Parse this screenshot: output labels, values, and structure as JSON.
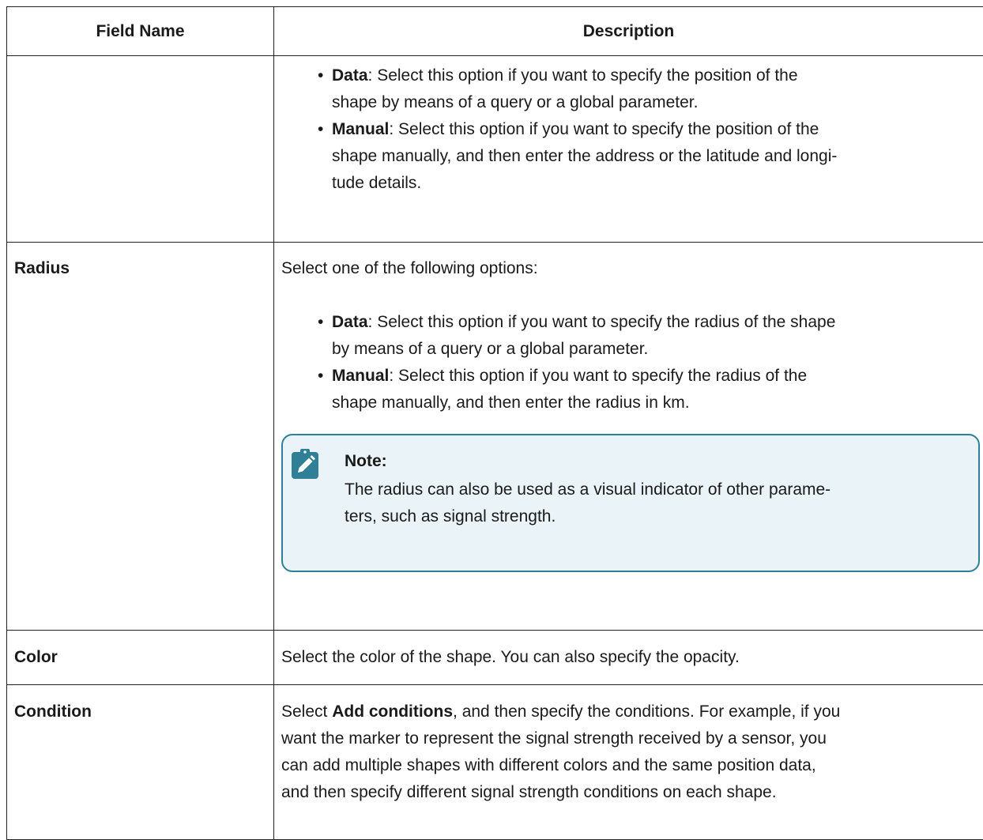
{
  "table": {
    "header": {
      "field_name": "Field Name",
      "description": "Description"
    },
    "row_position": {
      "field": "",
      "options": [
        {
          "term": "Data",
          "text_l1": ": Select this option if you want to specify the position of the",
          "text_l2": "shape by means of a query or a global parameter."
        },
        {
          "term": "Manual",
          "text_l1": ": Select this option if you want to specify the position of the",
          "text_l2": "shape manually, and then enter the address or the latitude and longi-",
          "text_l3": "tude details."
        }
      ]
    },
    "row_radius": {
      "field": "Radius",
      "lead": "Select one of the following options:",
      "options": [
        {
          "term": "Data",
          "text_l1": ": Select this option if you want to specify the radius of the shape",
          "text_l2": "by means of a query or a global parameter."
        },
        {
          "term": "Manual",
          "text_l1": ": Select this option if you want to specify the radius of the",
          "text_l2": "shape manually, and then enter the radius in km."
        }
      ],
      "note": {
        "icon": "pencil-clipboard-icon",
        "title": "Note:",
        "text_l1": "The radius can also be used as a visual indicator of other parame-",
        "text_l2": "ters, such as signal strength."
      }
    },
    "row_color": {
      "field": "Color",
      "text": "Select the color of the shape. You can also specify the opacity."
    },
    "row_condition": {
      "field": "Condition",
      "pre": "Select ",
      "bold": "Add conditions",
      "post_l1": ", and then specify the conditions. For example, if you",
      "l2": "want the marker to represent the signal strength received by a sensor, you",
      "l3": "can add multiple shapes with different colors and the same position data,",
      "l4": "and then specify different signal strength conditions on each shape."
    }
  },
  "colors": {
    "note_bg": "#eaf3f7",
    "note_border": "#2f7f97",
    "note_icon": "#2f7f97"
  }
}
